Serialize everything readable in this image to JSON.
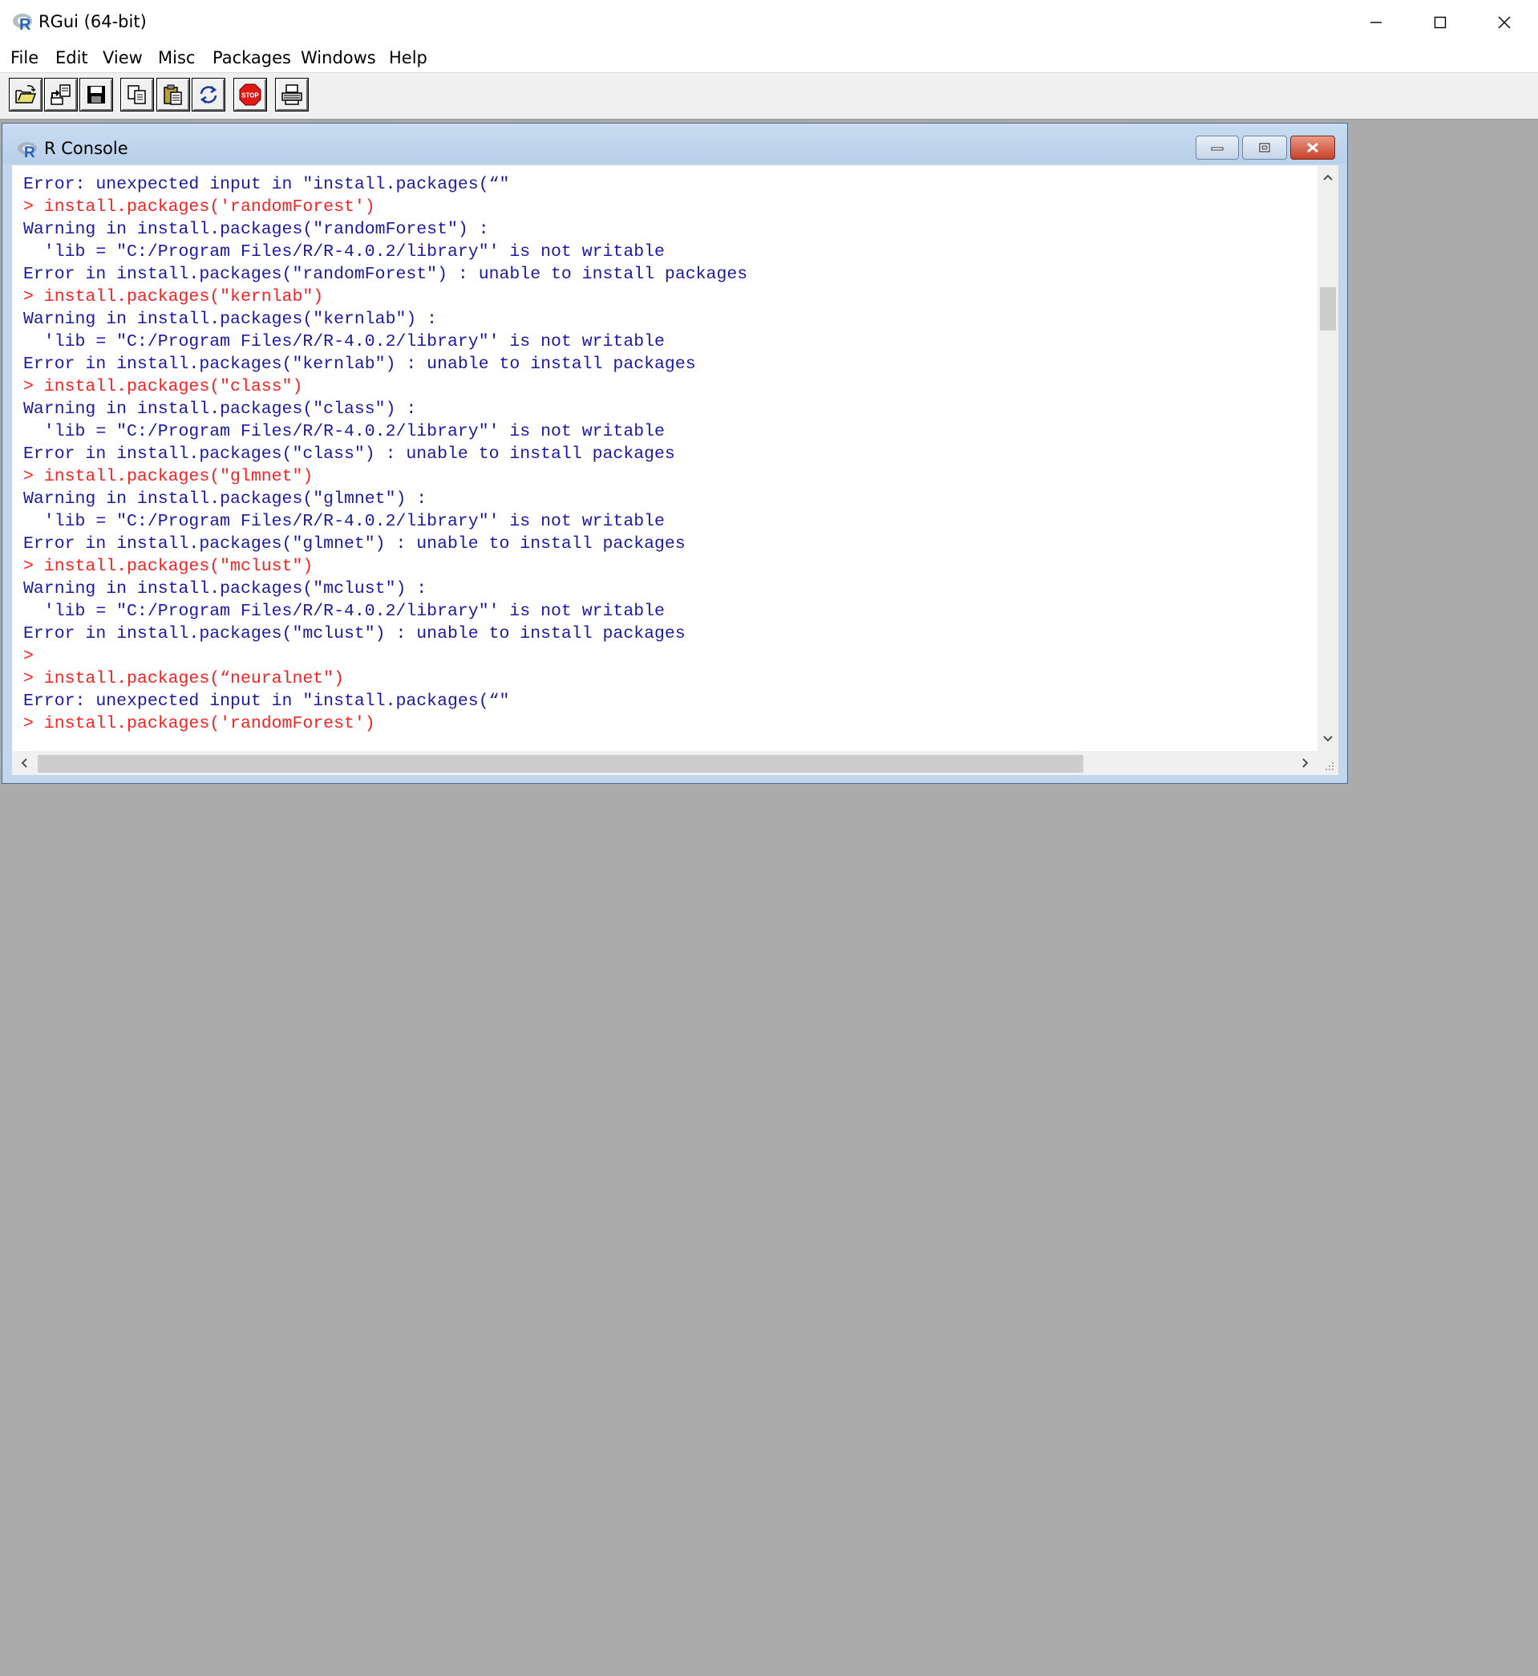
{
  "window": {
    "title": "RGui (64-bit)",
    "app_icon": "r-logo-icon",
    "controls": [
      "minimize-icon",
      "maximize-icon",
      "close-icon"
    ]
  },
  "menu": {
    "items": [
      "File",
      "Edit",
      "View",
      "Misc",
      "Packages",
      "Windows",
      "Help"
    ]
  },
  "toolbar": {
    "buttons": [
      {
        "name": "open-script",
        "icon": "open-folder-icon"
      },
      {
        "name": "load-workspace",
        "icon": "load-workspace-icon"
      },
      {
        "name": "save-workspace",
        "icon": "floppy-disk-icon"
      },
      {
        "name": "copy",
        "icon": "copy-icon"
      },
      {
        "name": "paste",
        "icon": "paste-icon"
      },
      {
        "name": "copy-paste",
        "icon": "refresh-icon"
      },
      {
        "name": "stop",
        "icon": "stop-sign-icon",
        "label": "STOP"
      },
      {
        "name": "print",
        "icon": "printer-icon"
      }
    ]
  },
  "console": {
    "title": "R Console",
    "colors": {
      "output": "#1a1aa6",
      "input": "#ff2020",
      "mdi_background": "#ababab"
    },
    "lines": [
      {
        "type": "output",
        "text": "Error: unexpected input in \"install.packages(“\""
      },
      {
        "type": "input",
        "text": "> install.packages('randomForest')"
      },
      {
        "type": "output",
        "text": "Warning in install.packages(\"randomForest\") :"
      },
      {
        "type": "output",
        "text": "  'lib = \"C:/Program Files/R/R-4.0.2/library\"' is not writable"
      },
      {
        "type": "output",
        "text": "Error in install.packages(\"randomForest\") : unable to install packages"
      },
      {
        "type": "input",
        "text": "> install.packages(\"kernlab\")"
      },
      {
        "type": "output",
        "text": "Warning in install.packages(\"kernlab\") :"
      },
      {
        "type": "output",
        "text": "  'lib = \"C:/Program Files/R/R-4.0.2/library\"' is not writable"
      },
      {
        "type": "output",
        "text": "Error in install.packages(\"kernlab\") : unable to install packages"
      },
      {
        "type": "input",
        "text": "> install.packages(\"class\")"
      },
      {
        "type": "output",
        "text": "Warning in install.packages(\"class\") :"
      },
      {
        "type": "output",
        "text": "  'lib = \"C:/Program Files/R/R-4.0.2/library\"' is not writable"
      },
      {
        "type": "output",
        "text": "Error in install.packages(\"class\") : unable to install packages"
      },
      {
        "type": "input",
        "text": "> install.packages(\"glmnet\")"
      },
      {
        "type": "output",
        "text": "Warning in install.packages(\"glmnet\") :"
      },
      {
        "type": "output",
        "text": "  'lib = \"C:/Program Files/R/R-4.0.2/library\"' is not writable"
      },
      {
        "type": "output",
        "text": "Error in install.packages(\"glmnet\") : unable to install packages"
      },
      {
        "type": "input",
        "text": "> install.packages(\"mclust\")"
      },
      {
        "type": "output",
        "text": "Warning in install.packages(\"mclust\") :"
      },
      {
        "type": "output",
        "text": "  'lib = \"C:/Program Files/R/R-4.0.2/library\"' is not writable"
      },
      {
        "type": "output",
        "text": "Error in install.packages(\"mclust\") : unable to install packages"
      },
      {
        "type": "input",
        "text": ">"
      },
      {
        "type": "input",
        "text": "> install.packages(“neuralnet\")"
      },
      {
        "type": "output",
        "text": "Error: unexpected input in \"install.packages(“\""
      },
      {
        "type": "input",
        "text": "> install.packages('randomForest')"
      }
    ]
  }
}
